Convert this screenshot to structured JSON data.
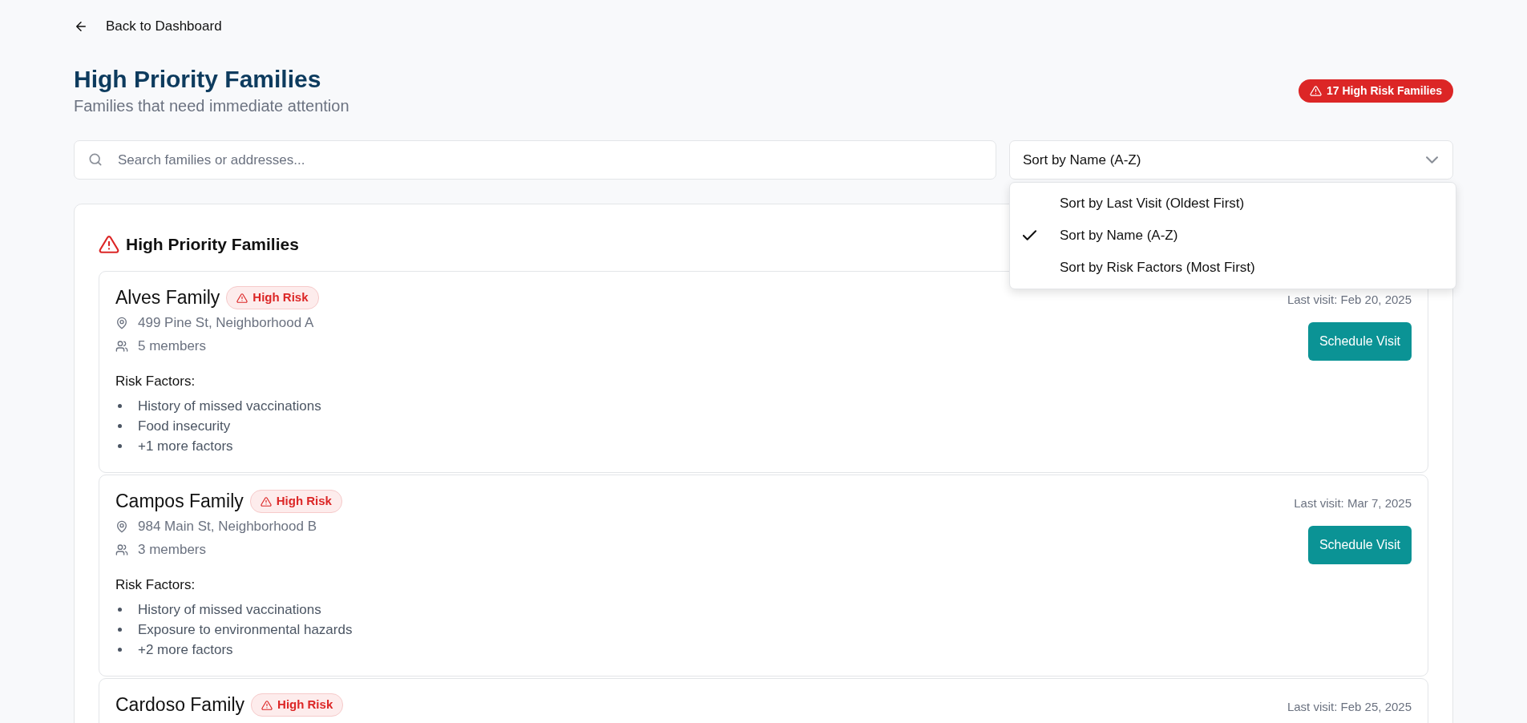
{
  "back_link": "Back to Dashboard",
  "header": {
    "title": "High Priority Families",
    "subtitle": "Families that need immediate attention",
    "badge": "17 High Risk Families"
  },
  "search": {
    "placeholder": "Search families or addresses..."
  },
  "sort": {
    "value": "Sort by Name (A-Z)",
    "expanded": true,
    "options": [
      {
        "label": "Sort by Last Visit (Oldest First)",
        "selected": false
      },
      {
        "label": "Sort by Name (A-Z)",
        "selected": true
      },
      {
        "label": "Sort by Risk Factors (Most First)",
        "selected": false
      }
    ]
  },
  "panel": {
    "title": "High Priority Families",
    "families": [
      {
        "name": "Alves Family",
        "risk": "High Risk",
        "address": "499 Pine St, Neighborhood A",
        "members": "5 members",
        "last_visit": "Last visit: Feb 20, 2025",
        "button": "Schedule Visit",
        "risk_label": "Risk Factors:",
        "factors": [
          "History of missed vaccinations",
          "Food insecurity",
          "+1 more factors"
        ]
      },
      {
        "name": "Campos Family",
        "risk": "High Risk",
        "address": "984 Main St, Neighborhood B",
        "members": "3 members",
        "last_visit": "Last visit: Mar 7, 2025",
        "button": "Schedule Visit",
        "risk_label": "Risk Factors:",
        "factors": [
          "History of missed vaccinations",
          "Exposure to environmental hazards",
          "+2 more factors"
        ]
      },
      {
        "name": "Cardoso Family",
        "risk": "High Risk",
        "last_visit": "Last visit: Feb 25, 2025"
      }
    ]
  }
}
